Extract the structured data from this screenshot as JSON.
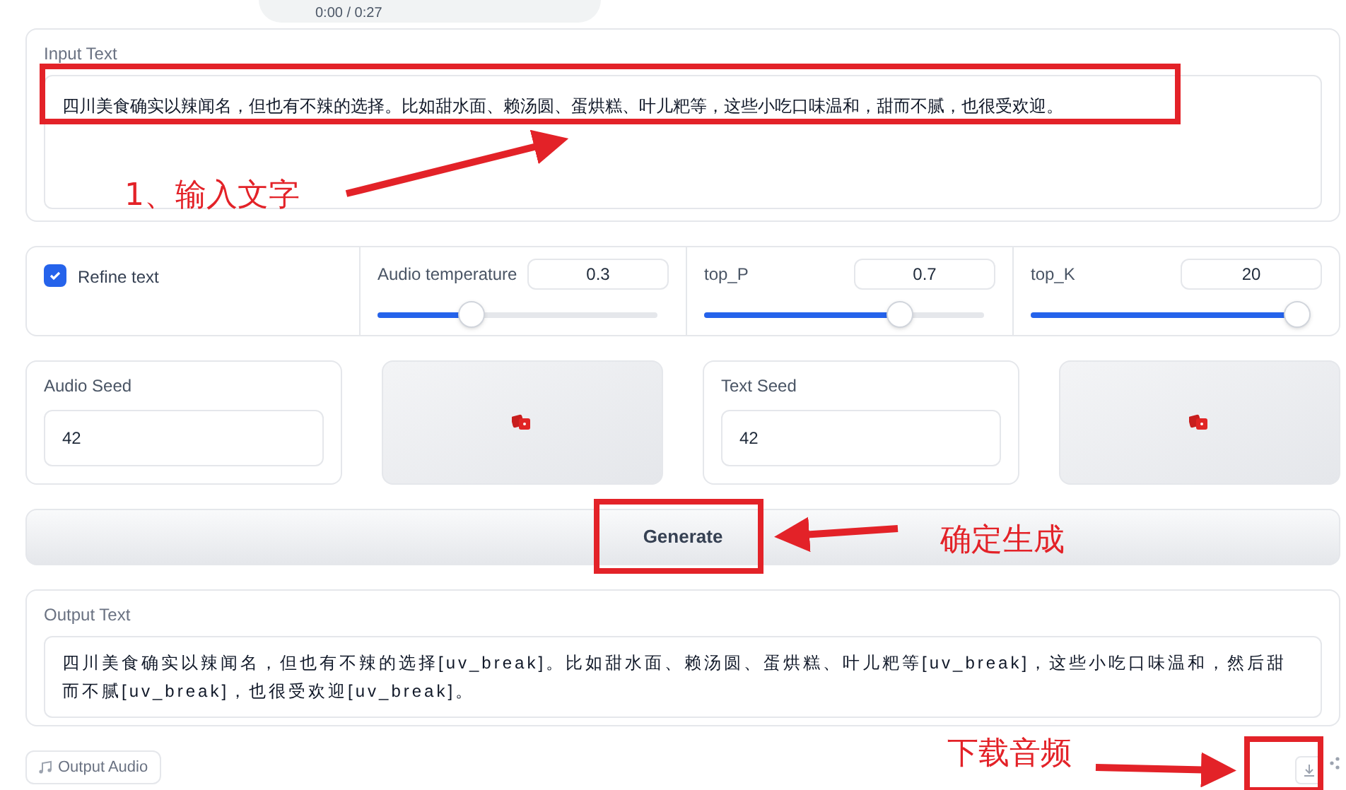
{
  "player": {
    "time": "0:00 / 0:27"
  },
  "input_text": {
    "label": "Input Text",
    "value": "四川美食确实以辣闻名，但也有不辣的选择。比如甜水面、赖汤圆、蛋烘糕、叶儿粑等，这些小吃口味温和，甜而不腻，也很受欢迎。"
  },
  "refine_text": {
    "label": "Refine text",
    "checked": true
  },
  "sliders": [
    {
      "label": "Audio temperature",
      "value": "0.3",
      "level": 0.32
    },
    {
      "label": "top_P",
      "value": "0.7",
      "level": 0.72
    },
    {
      "label": "top_K",
      "value": "20",
      "level": 1
    }
  ],
  "seeds": [
    {
      "label": "Audio Seed",
      "value": "42"
    },
    {
      "label": "Text Seed",
      "value": "42"
    }
  ],
  "generate_button": "Generate",
  "output_text": {
    "label": "Output Text",
    "value": "四川美食确实以辣闻名，但也有不辣的选择[uv_break]。比如甜水面、赖汤圆、蛋烘糕、叶儿粑等[uv_break]，这些小吃口味温和，然后甜而不腻[uv_break]，也很受欢迎[uv_break]。"
  },
  "output_audio": {
    "label": "Output Audio"
  },
  "annotations": [
    {
      "label": "1、输入文字"
    },
    {
      "label": "确定生成"
    },
    {
      "label": "下载音频"
    }
  ]
}
